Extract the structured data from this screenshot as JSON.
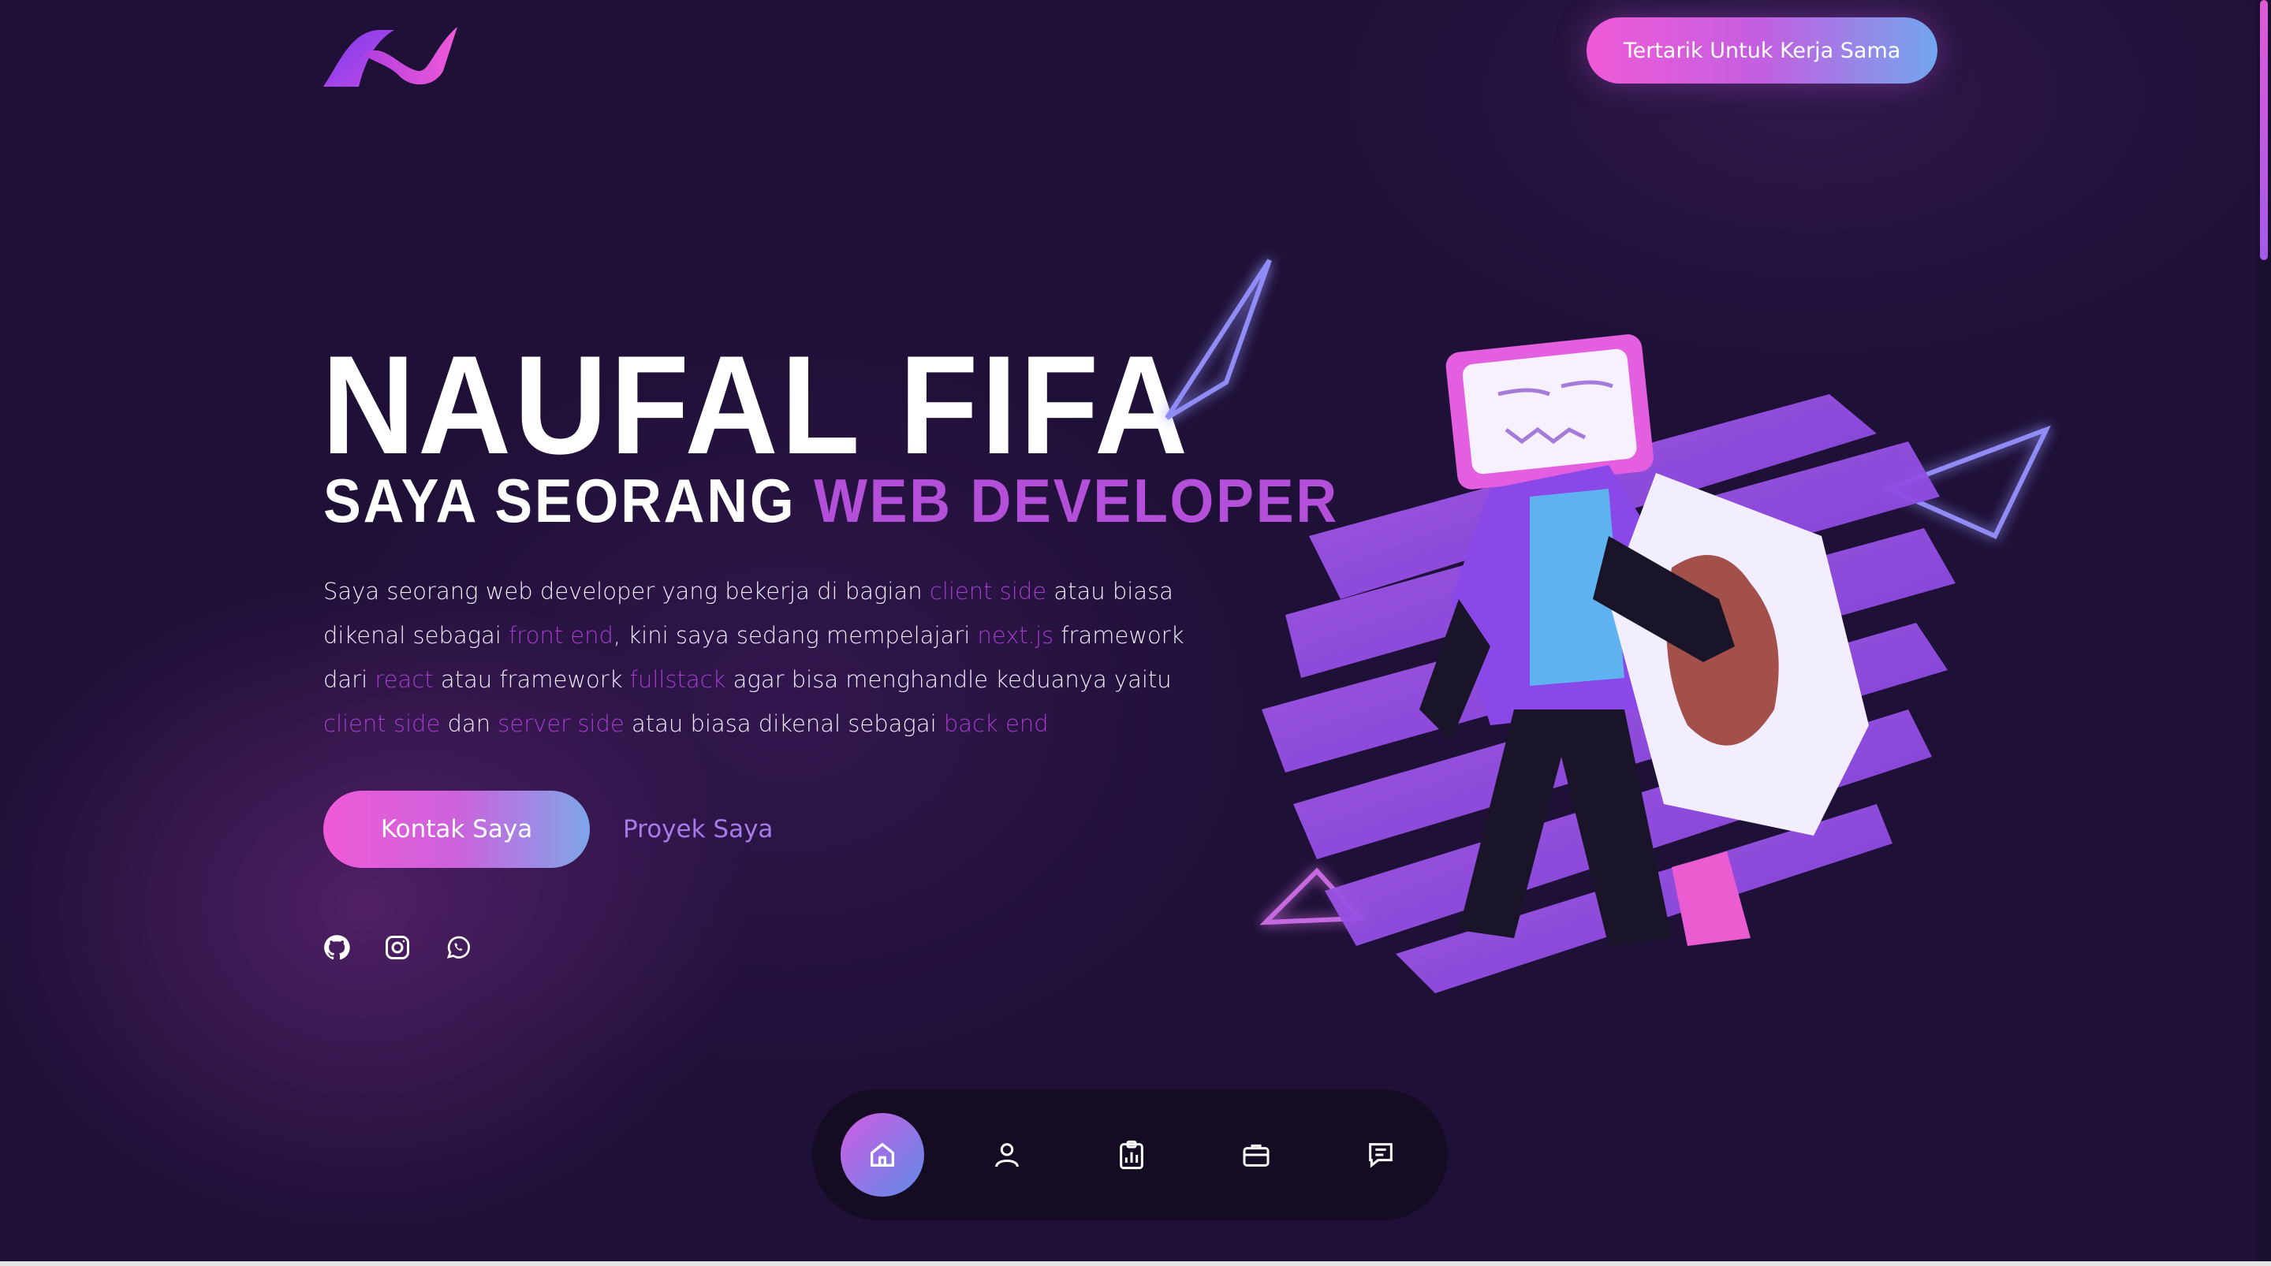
{
  "header": {
    "logo_icon": "N-wave-logo",
    "cta_label": "Tertarik Untuk Kerja Sama"
  },
  "hero": {
    "name": "NAUFAL FIFA",
    "subtitle_prefix": "SAYA SEORANG ",
    "subtitle_accent": "WEB DEVELOPER",
    "description": [
      {
        "t": "Saya seorang web developer yang bekerja di bagian ",
        "hl": false
      },
      {
        "t": "client side",
        "hl": true
      },
      {
        "t": " atau biasa dikenal sebagai ",
        "hl": false
      },
      {
        "t": "front end",
        "hl": true
      },
      {
        "t": ", kini saya sedang mempelajari ",
        "hl": false
      },
      {
        "t": "next.js",
        "hl": true
      },
      {
        "t": " framework dari ",
        "hl": false
      },
      {
        "t": "react",
        "hl": true
      },
      {
        "t": " atau framework ",
        "hl": false
      },
      {
        "t": "fullstack",
        "hl": true
      },
      {
        "t": " agar bisa menghandle keduanya yaitu ",
        "hl": false
      },
      {
        "t": "client side",
        "hl": true
      },
      {
        "t": " dan ",
        "hl": false
      },
      {
        "t": "server side",
        "hl": true
      },
      {
        "t": " atau biasa dikenal sebagai ",
        "hl": false
      },
      {
        "t": "back end",
        "hl": true
      }
    ],
    "primary_button": "Kontak Saya",
    "secondary_button": "Proyek Saya"
  },
  "social": [
    "github-icon",
    "instagram-icon",
    "whatsapp-icon"
  ],
  "dock": {
    "items": [
      "home-icon",
      "user-icon",
      "clipboard-chart-icon",
      "briefcase-icon",
      "chat-icon"
    ],
    "active_index": 0
  },
  "colors": {
    "background": "#1e1036",
    "accent_purple": "#b34fd8",
    "gradient_pink": "#f05ad8",
    "gradient_blue": "#72a6ee"
  }
}
